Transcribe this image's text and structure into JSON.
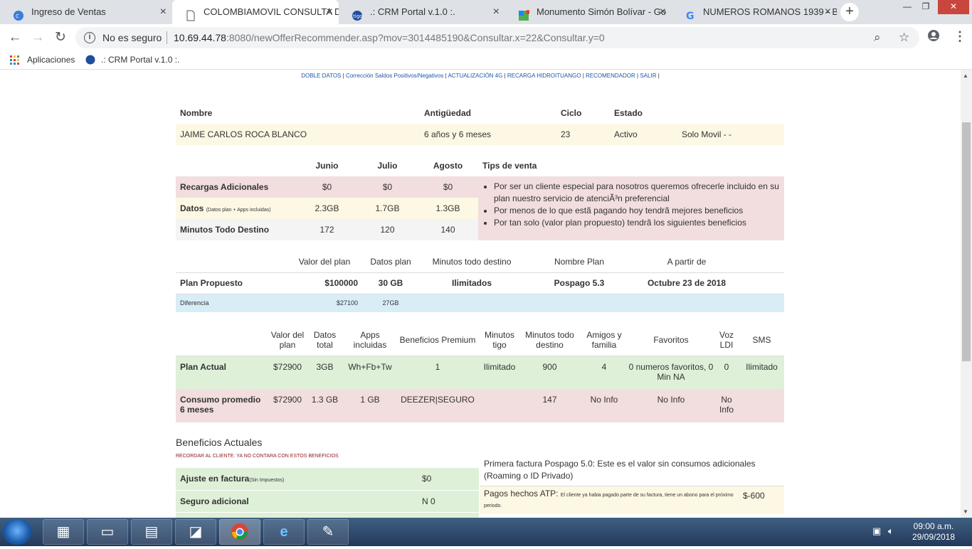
{
  "browser": {
    "tabs": [
      {
        "title": "Ingreso de Ventas",
        "active": false
      },
      {
        "title": "COLOMBIAMOVIL CONSULTA DI",
        "active": true
      },
      {
        "title": ".: CRM Portal v.1.0 :.",
        "active": false
      },
      {
        "title": "Monumento Simón Bolívar - Go",
        "active": false
      },
      {
        "title": "NUMEROS ROMANOS 1939 - B",
        "active": false
      }
    ],
    "security_label": "No es seguro",
    "url_host": "10.69.44.78",
    "url_rest": ":8080/newOfferRecommender.asp?mov=3014485190&Consultar.x=22&Consultar.y=0",
    "bookmarks": [
      "Aplicaciones",
      ".: CRM Portal v.1.0 :."
    ]
  },
  "menu": [
    "DOBLE DATOS",
    "Corrección Saldos Positivos/Negativos",
    "ACTUALIZACIÓN 4G",
    "RECARGA HIDROITUANGO",
    "RECOMENDADOR",
    "SALIR"
  ],
  "customer": {
    "headers": [
      "Nombre",
      "Antigüedad",
      "Ciclo",
      "Estado"
    ],
    "name": "JAIME CARLOS ROCA BLANCO",
    "antiguedad": "6 años y 6 meses",
    "ciclo": "23",
    "estado": "Activo",
    "tipo": "Solo Movil - -"
  },
  "usage": {
    "months": [
      "Junio",
      "Julio",
      "Agosto"
    ],
    "tips_title": "Tips de venta",
    "rows": [
      {
        "label": "Recargas Adicionales",
        "sub": "",
        "values": [
          "$0",
          "$0",
          "$0"
        ]
      },
      {
        "label": "Datos",
        "sub": "(Datos plan + Apps incluidas)",
        "values": [
          "2.3GB",
          "1.7GB",
          "1.3GB"
        ]
      },
      {
        "label": "Minutos Todo Destino",
        "sub": "",
        "values": [
          "172",
          "120",
          "140"
        ]
      }
    ],
    "tips": [
      "Por ser un cliente especial para nosotros queremos ofrecerle incluido en su plan nuestro servicio de atenciÃ³n preferencial",
      "Por menos de lo que estã pagando hoy tendrã mejores beneficios",
      "Por tan solo (valor plan propuesto) tendrã los siguientes beneficios"
    ]
  },
  "proposed": {
    "headers": [
      "Valor del plan",
      "Datos plan",
      "Minutos todo destino",
      "Nombre Plan",
      "A partir de"
    ],
    "label": "Plan Propuesto",
    "valor": "$100000",
    "datos": "30 GB",
    "minutos": "Ilimitados",
    "nombre": "Pospago 5.3",
    "desde": "Octubre 23 de 2018",
    "diff_label": "Diferencia",
    "diff_valor": "$27100",
    "diff_datos": "27GB"
  },
  "current": {
    "headers": [
      "Valor del plan",
      "Datos total",
      "Apps incluidas",
      "Beneficios Premium",
      "Minutos tigo",
      "Minutos todo destino",
      "Amigos y familia",
      "Favoritos",
      "Voz LDI",
      "SMS"
    ],
    "plan_actual": {
      "label": "Plan Actual",
      "values": [
        "$72900",
        "3GB",
        "Wh+Fb+Tw",
        "1",
        "Ilimitado",
        "900",
        "4",
        "0 numeros favoritos, 0 Min NA",
        "0",
        "Ilimitado"
      ]
    },
    "consumo": {
      "label": "Consumo promedio 6 meses",
      "values": [
        "$72900",
        "1.3 GB",
        "1 GB",
        "DEEZER|SEGURO",
        "",
        "147",
        "No Info",
        "No Info",
        "No Info",
        ""
      ]
    }
  },
  "benefits": {
    "title": "Beneficios Actuales",
    "warning": "RECORDAR AL CLIENTE: YA NO CONTARA CON ESTOS BENEFICIOS",
    "items": [
      {
        "label": "Ajuste en factura",
        "sub": "(Sin Impuestos)",
        "value": "$0"
      },
      {
        "label": "Seguro adicional",
        "sub": "",
        "value": "N 0"
      }
    ],
    "note": "Primera factura Pospago 5.0: Este es el valor sin consumos adicionales (Roaming o ID Privado)",
    "pagos_label": "Pagos hechos ATP:",
    "pagos_sub": "El cliente ya habia pagado parte de su factura, tiene un abono para el próximo periodo.",
    "pagos_value": "$-600"
  },
  "taskbar": {
    "time": "09:00 a.m.",
    "date": "29/09/2018"
  }
}
